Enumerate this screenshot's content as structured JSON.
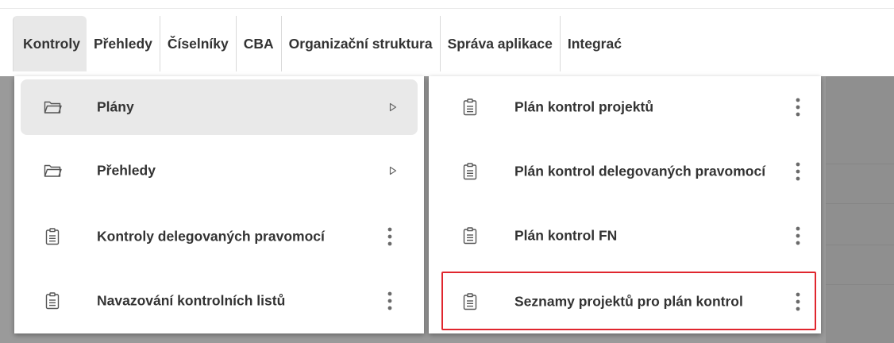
{
  "menubar": {
    "tabs": [
      {
        "label": "Kontroly"
      },
      {
        "label": "Přehledy"
      },
      {
        "label": "Číselníky"
      },
      {
        "label": "CBA"
      },
      {
        "label": "Organizační struktura"
      },
      {
        "label": "Správa aplikace"
      },
      {
        "label": "Integrać"
      }
    ]
  },
  "left_menu": {
    "items": [
      {
        "label": "Plány",
        "icon": "folder-icon",
        "has_submenu": true
      },
      {
        "label": "Přehledy",
        "icon": "folder-icon",
        "has_submenu": true
      },
      {
        "label": "Kontroly delegovaných pravomocí",
        "icon": "clipboard-icon"
      },
      {
        "label": "Navazování kontrolních listů",
        "icon": "clipboard-icon"
      }
    ]
  },
  "right_menu": {
    "items": [
      {
        "label": "Plán kontrol projektů",
        "icon": "clipboard-icon"
      },
      {
        "label": "Plán kontrol delegovaných pravomocí",
        "icon": "clipboard-icon"
      },
      {
        "label": "Plán kontrol FN",
        "icon": "clipboard-icon"
      },
      {
        "label": "Seznamy projektů pro plán kontrol",
        "icon": "clipboard-icon"
      }
    ]
  },
  "colors": {
    "highlight": "#e0262e",
    "hover_bg": "#e9e9e9",
    "backdrop": "#9a9a9a"
  }
}
